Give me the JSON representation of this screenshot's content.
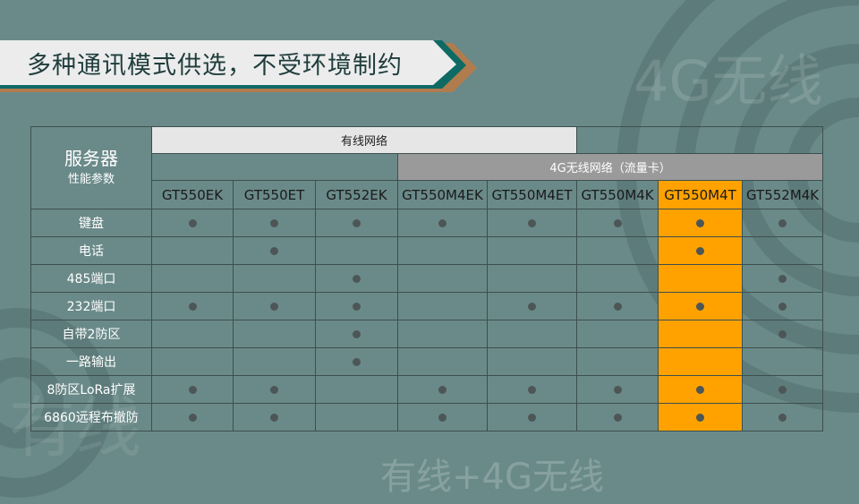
{
  "title": "多种通讯模式供选，不受环境制约",
  "watermarks": {
    "top_right": "4G无线",
    "bottom": "有线+4G无线",
    "left": "有线"
  },
  "table": {
    "corner_title": "服务器",
    "corner_subtitle": "性能参数",
    "group_wired": "有线网络",
    "group_4g": "4G无线网络（流量卡）",
    "models": [
      "GT550EK",
      "GT550ET",
      "GT552EK",
      "GT550M4EK",
      "GT550M4ET",
      "GT550M4K",
      "GT550M4T",
      "GT552M4K"
    ],
    "highlight_model_index": 6,
    "highlight_color": "#ffa200",
    "features": [
      {
        "name": "键盘",
        "support": [
          true,
          true,
          true,
          true,
          true,
          true,
          true,
          true
        ]
      },
      {
        "name": "电话",
        "support": [
          false,
          true,
          false,
          false,
          false,
          false,
          true,
          false
        ]
      },
      {
        "name": "485端口",
        "support": [
          false,
          false,
          true,
          false,
          false,
          false,
          false,
          true
        ]
      },
      {
        "name": "232端口",
        "support": [
          true,
          true,
          true,
          false,
          true,
          true,
          true,
          true
        ]
      },
      {
        "name": "自带2防区",
        "support": [
          false,
          false,
          true,
          false,
          false,
          false,
          false,
          true
        ]
      },
      {
        "name": "一路输出",
        "support": [
          false,
          false,
          true,
          false,
          false,
          false,
          false,
          false
        ]
      },
      {
        "name": "8防区LoRa扩展",
        "support": [
          true,
          true,
          false,
          true,
          true,
          true,
          true,
          true
        ]
      },
      {
        "name": "6860远程布撤防",
        "support": [
          true,
          true,
          false,
          true,
          true,
          true,
          true,
          true
        ]
      }
    ]
  }
}
